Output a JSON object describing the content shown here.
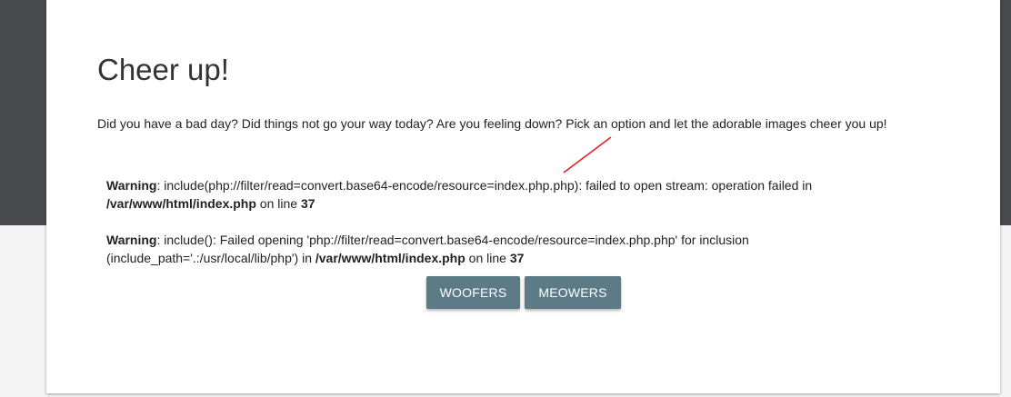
{
  "page": {
    "title": "Cheer up!",
    "intro": "Did you have a bad day? Did things not go your way today? Are you feeling down? Pick an option and let the adorable images cheer you up!"
  },
  "warnings": [
    {
      "label": "Warning",
      "message_part1": ": include(php://filter/read=convert.base64-encode/resource=index.php.php): failed to open stream: operation failed in ",
      "path": "/var/www/html/index.php",
      "on_line_text": " on line ",
      "line_number": "37"
    },
    {
      "label": "Warning",
      "message_part1": ": include(): Failed opening 'php://filter/read=convert.base64-encode/resource=index.php.php' for inclusion (include_path='.:/usr/local/lib/php') in ",
      "path": "/var/www/html/index.php",
      "on_line_text": " on line ",
      "line_number": "37"
    }
  ],
  "buttons": {
    "woofers_label": "WOOFERS",
    "meowers_label": "MEOWERS"
  },
  "colors": {
    "header_bg": "#47494d",
    "page_bg": "#f4f4f4",
    "button_bg": "#5d7a87",
    "annotation": "#e8202a"
  }
}
